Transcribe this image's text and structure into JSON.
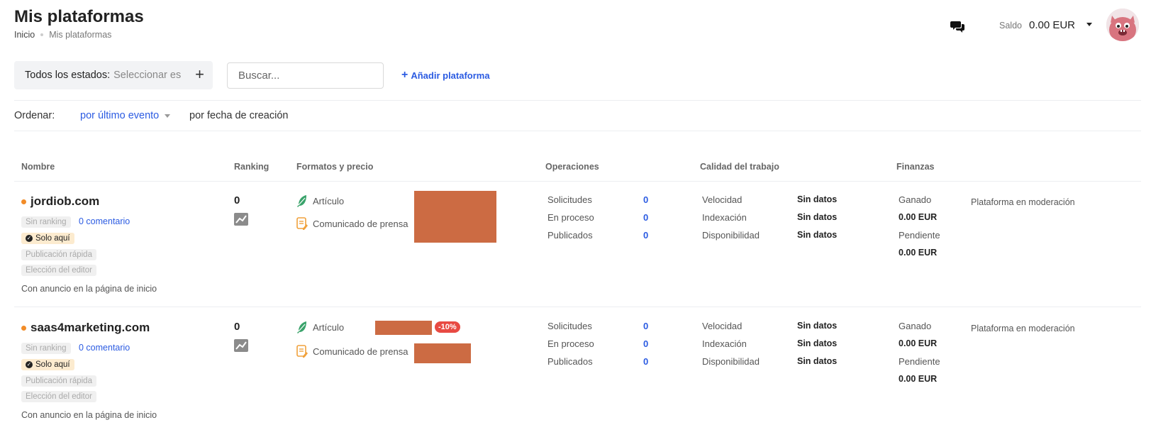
{
  "header": {
    "title": "Mis plataformas",
    "breadcrumb": [
      "Inicio",
      "Mis plataformas"
    ],
    "balance_label": "Saldo",
    "balance_value": "0.00 EUR"
  },
  "toolbar": {
    "status_filter_label": "Todos los estados:",
    "status_filter_value": "Seleccionar es",
    "search_placeholder": "Buscar...",
    "add_platform_label": "Añadir plataforma"
  },
  "sort": {
    "label": "Ordenar:",
    "active": "por último evento",
    "other": "por fecha de creación"
  },
  "table": {
    "headers": [
      "Nombre",
      "Ranking",
      "Formatos y precio",
      "Operaciones",
      "Calidad del trabajo",
      "Finanzas"
    ],
    "rows": [
      {
        "name": "jordiob.com",
        "badge_ranking": "Sin ranking",
        "comment_link": "0 comentario",
        "badge_solo": "Solo aquí",
        "badge_fast": "Publicación rápida",
        "badge_editor": "Elección del editor",
        "homepage_note": "Con anuncio en la página de inicio",
        "ranking": "0",
        "formats": [
          "Artículo",
          "Comunicado de prensa"
        ],
        "discount": "",
        "ops": [
          {
            "label": "Solicitudes",
            "value": "0"
          },
          {
            "label": "En proceso",
            "value": "0"
          },
          {
            "label": "Publicados",
            "value": "0"
          }
        ],
        "quality": [
          {
            "label": "Velocidad",
            "value": "Sin datos"
          },
          {
            "label": "Indexación",
            "value": "Sin datos"
          },
          {
            "label": "Disponibilidad",
            "value": "Sin datos"
          }
        ],
        "finance": {
          "earned_label": "Ganado",
          "earned_value": "0.00 EUR",
          "pending_label": "Pendiente",
          "pending_value": "0.00 EUR"
        },
        "status": "Plataforma en moderación"
      },
      {
        "name": "saas4marketing.com",
        "badge_ranking": "Sin ranking",
        "comment_link": "0 comentario",
        "badge_solo": "Solo aquí",
        "badge_fast": "Publicación rápida",
        "badge_editor": "Elección del editor",
        "homepage_note": "Con anuncio en la página de inicio",
        "ranking": "0",
        "formats": [
          "Artículo",
          "Comunicado de prensa"
        ],
        "discount": "-10%",
        "ops": [
          {
            "label": "Solicitudes",
            "value": "0"
          },
          {
            "label": "En proceso",
            "value": "0"
          },
          {
            "label": "Publicados",
            "value": "0"
          }
        ],
        "quality": [
          {
            "label": "Velocidad",
            "value": "Sin datos"
          },
          {
            "label": "Indexación",
            "value": "Sin datos"
          },
          {
            "label": "Disponibilidad",
            "value": "Sin datos"
          }
        ],
        "finance": {
          "earned_label": "Ganado",
          "earned_value": "0.00 EUR",
          "pending_label": "Pendiente",
          "pending_value": "0.00 EUR"
        },
        "status": "Plataforma en moderación"
      }
    ]
  },
  "colors": {
    "accent": "#2b5be2",
    "price_redacted": "#cc6b43",
    "discount": "#e84a43",
    "status_dot": "#f28c28"
  },
  "icons": [
    "chat-icon",
    "caret-down-icon",
    "avatar-monster",
    "plus-icon",
    "feather-icon",
    "press-release-icon",
    "chart-icon",
    "check-icon"
  ]
}
